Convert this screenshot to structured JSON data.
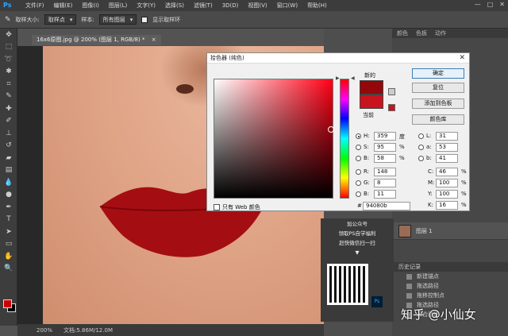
{
  "app": {
    "logo": "Ps"
  },
  "menubar": {
    "items": [
      "文件(F)",
      "编辑(E)",
      "图像(I)",
      "图层(L)",
      "文字(Y)",
      "选择(S)",
      "滤镜(T)",
      "3D(D)",
      "视图(V)",
      "窗口(W)",
      "帮助(H)"
    ],
    "window_buttons": [
      "—",
      "□",
      "✕"
    ]
  },
  "options": {
    "sample_size_label": "取样大小:",
    "sample_size_value": "取样点",
    "sample_label": "样本:",
    "sample_value": "所有图层",
    "show_ring_label": "显示取样环"
  },
  "document": {
    "tab_title": "16x6原图.jpg @ 200% (图层 1, RGB/8) *",
    "tab_close": "×",
    "zoom": "200%",
    "doc_size": "文档:5.86M/12.0M"
  },
  "right_panel": {
    "tabs": [
      "颜色",
      "色板",
      "动作"
    ]
  },
  "layers": [
    {
      "name": "图层 1"
    }
  ],
  "history": {
    "title": "历史记录",
    "items": [
      "新建锚点",
      "拖选路径",
      "拖移控制点",
      "拖选路径",
      "闭合路径"
    ]
  },
  "promo": {
    "line1": "加公众号",
    "line2": "领取PS自学福利",
    "line3": "赶快微信扫一扫",
    "arrow": "▼",
    "ps_badge": "Ps"
  },
  "watermark": "知乎 @小仙女",
  "color_picker": {
    "title": "拾色器 (纯色)",
    "close": "✕",
    "new_label": "新的",
    "current_label": "当前",
    "buttons": {
      "ok": "确定",
      "reset": "复位",
      "add_swatch": "添加到色板",
      "libraries": "颜色库"
    },
    "hsb": {
      "h": "359",
      "h_unit": "度",
      "s": "95",
      "s_unit": "%",
      "b": "58",
      "b_unit": "%"
    },
    "rgb": {
      "r": "148",
      "g": "8",
      "b": "11"
    },
    "lab": {
      "l": "31",
      "a": "53",
      "b": "41"
    },
    "cmyk": {
      "c": "46",
      "m": "100",
      "y": "100",
      "k": "16",
      "unit": "%"
    },
    "hex": "94080b",
    "hex_label": "#",
    "web_only_label": "只有 Web 颜色",
    "labels": {
      "H": "H:",
      "S": "S:",
      "B": "B:",
      "R": "R:",
      "G": "G:",
      "Bb": "B:",
      "L": "L:",
      "a": "a:",
      "b": "b:",
      "C": "C:",
      "M": "M:",
      "Y": "Y:",
      "K": "K:"
    }
  },
  "colors": {
    "new_color": "#94080b",
    "current_color": "#c8141e",
    "foreground": "#cc0000",
    "background": "#000000"
  }
}
